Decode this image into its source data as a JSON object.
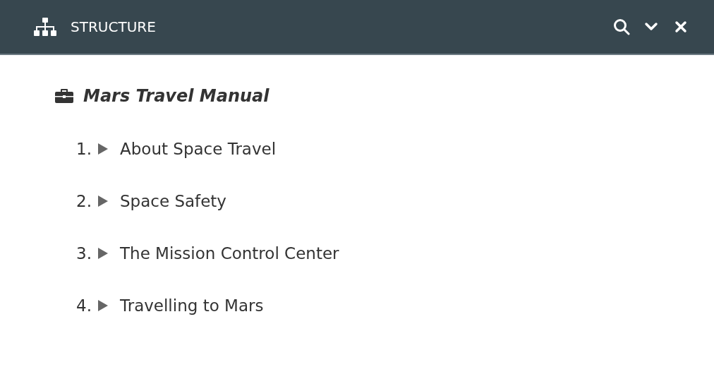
{
  "header": {
    "title": "STRUCTURE"
  },
  "document": {
    "title": "Mars Travel Manual",
    "chapters": [
      {
        "number": "1.",
        "label": "About Space Travel",
        "expanded": false
      },
      {
        "number": "2.",
        "label": "Space Safety",
        "expanded": false
      },
      {
        "number": "3.",
        "label": "The Mission Control Center",
        "expanded": false
      },
      {
        "number": "4.",
        "label": "Travelling to Mars",
        "expanded": false
      }
    ]
  }
}
